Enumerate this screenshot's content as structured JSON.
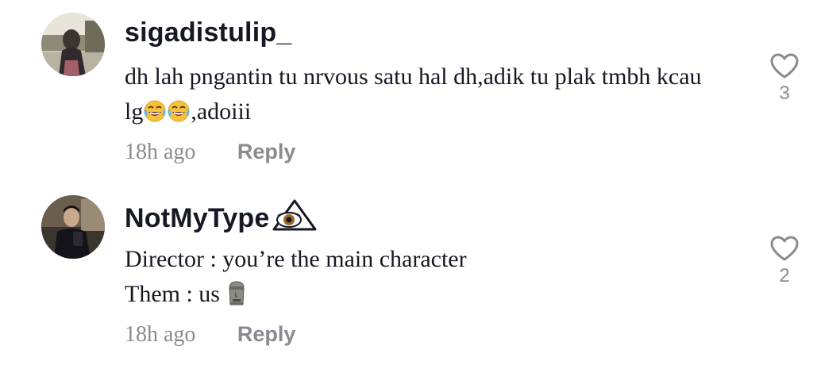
{
  "comments": [
    {
      "username": "sigadistulip_",
      "lines": [
        "dh lah pngantin tu nrvous satu hal dh,adik tu plak tmbh kcau",
        "lg",
        ",adoiii"
      ],
      "time": "18h ago",
      "reply_label": "Reply",
      "like_count": "3",
      "username_emoji": "",
      "emojis": [
        "face-with-tears-of-joy-emoji",
        "face-with-tears-of-joy-emoji"
      ]
    },
    {
      "username": "NotMyType",
      "username_emoji": "eye-in-triangle-emoji",
      "lines": [
        "Director : you’re the main character",
        "Them : us"
      ],
      "emojis": [
        "moai-emoji"
      ],
      "time": "18h ago",
      "reply_label": "Reply",
      "like_count": "2"
    }
  ],
  "colors": {
    "text_primary": "#161823",
    "text_secondary": "#8a8b91",
    "background": "#ffffff"
  }
}
